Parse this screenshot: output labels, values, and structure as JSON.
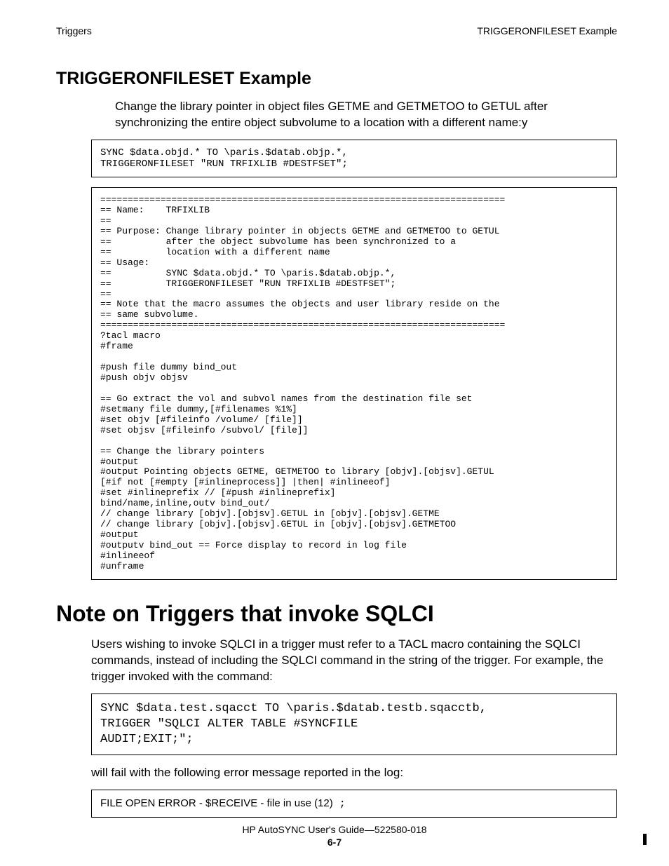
{
  "header": {
    "left": "Triggers",
    "right": "TRIGGERONFILESET Example"
  },
  "section1": {
    "title": "TRIGGERONFILESET Example",
    "intro": "Change the library pointer in object files GETME and GETMETOO to GETUL after synchronizing the entire object subvolume to a location with a different name:y",
    "code1": "SYNC $data.objd.* TO \\paris.$datab.objp.*,\nTRIGGERONFILESET \"RUN TRFIXLIB #DESTFSET\";",
    "code2": "==========================================================================\n== Name:    TRFIXLIB\n==\n== Purpose: Change library pointer in objects GETME and GETMETOO to GETUL\n==          after the object subvolume has been synchronized to a\n==          location with a different name\n== Usage:\n==          SYNC $data.objd.* TO \\paris.$datab.objp.*,\n==          TRIGGERONFILESET \"RUN TRFIXLIB #DESTFSET\";\n==\n== Note that the macro assumes the objects and user library reside on the\n== same subvolume.\n==========================================================================\n?tacl macro\n#frame\n\n#push file dummy bind_out\n#push objv objsv\n\n== Go extract the vol and subvol names from the destination file set\n#setmany file dummy,[#filenames %1%]\n#set objv [#fileinfo /volume/ [file]]\n#set objsv [#fileinfo /subvol/ [file]]\n\n== Change the library pointers\n#output\n#output Pointing objects GETME, GETMETOO to library [objv].[objsv].GETUL\n[#if not [#empty [#inlineprocess]] |then| #inlineeof]\n#set #inlineprefix // [#push #inlineprefix]\nbind/name,inline,outv bind_out/\n// change library [objv].[objsv].GETUL in [objv].[objsv].GETME\n// change library [objv].[objsv].GETUL in [objv].[objsv].GETMETOO\n#output\n#outputv bind_out == Force display to record in log file\n#inlineeof\n#unframe"
  },
  "section2": {
    "title": "Note on Triggers that invoke SQLCI",
    "p1": "Users wishing to invoke SQLCI in a trigger must refer to a TACL macro containing the SQLCI commands, instead of including the SQLCI command in the string of the trigger. For example, the trigger invoked with the command:",
    "code1": "SYNC $data.test.sqacct TO \\paris.$datab.testb.sqacctb,\nTRIGGER \"SQLCI ALTER TABLE #SYNCFILE\nAUDIT;EXIT;\";",
    "p2": "will fail with the following error message reported in the log:",
    "err_text": "FILE OPEN ERROR - $RECEIVE - file in use (12)",
    "err_semi": " ;"
  },
  "footer": {
    "line1": "HP AutoSYNC User's Guide—522580-018",
    "line2": "6-7"
  }
}
